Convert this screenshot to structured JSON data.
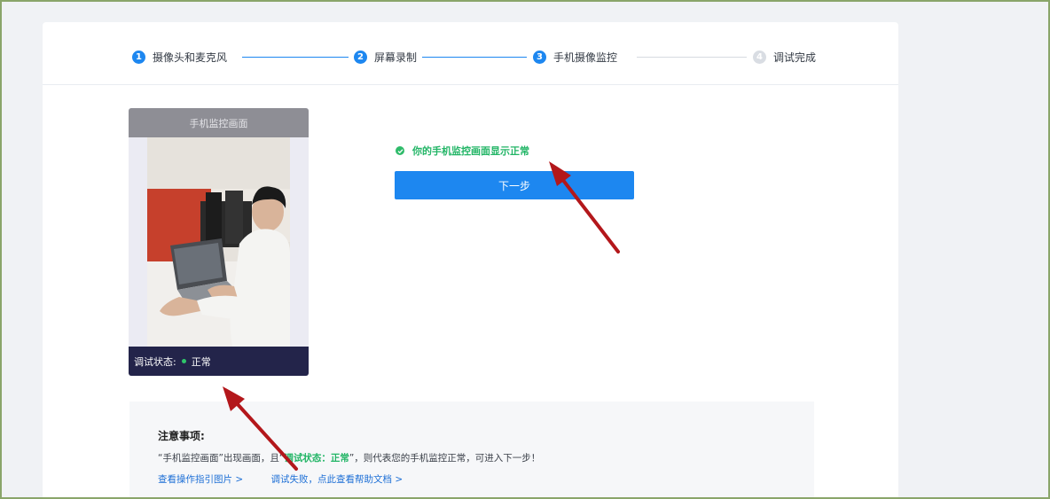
{
  "steps": [
    {
      "number": "1",
      "label": "摄像头和麦克风"
    },
    {
      "number": "2",
      "label": "屏幕录制"
    },
    {
      "number": "3",
      "label": "手机摄像监控"
    },
    {
      "number": "4",
      "label": "调试完成"
    }
  ],
  "phone_panel": {
    "header": "手机监控画面",
    "status_label": "调试状态:",
    "status_value": "正常"
  },
  "main": {
    "success_message": "你的手机监控画面显示正常",
    "next_button": "下一步"
  },
  "notes": {
    "title": "注意事项:",
    "line_part1": "“手机监控画面”出现画面，且“",
    "line_highlight": "调试状态：正常",
    "line_part2": "”，则代表您的手机监控正常，可进入下一步！",
    "link_guide": "查看操作指引图片 >",
    "link_help": "调试失败，点此查看帮助文档 >"
  },
  "colors": {
    "accent": "#1d87f0",
    "success": "#22b566",
    "annotation_arrow": "#b3171b"
  }
}
